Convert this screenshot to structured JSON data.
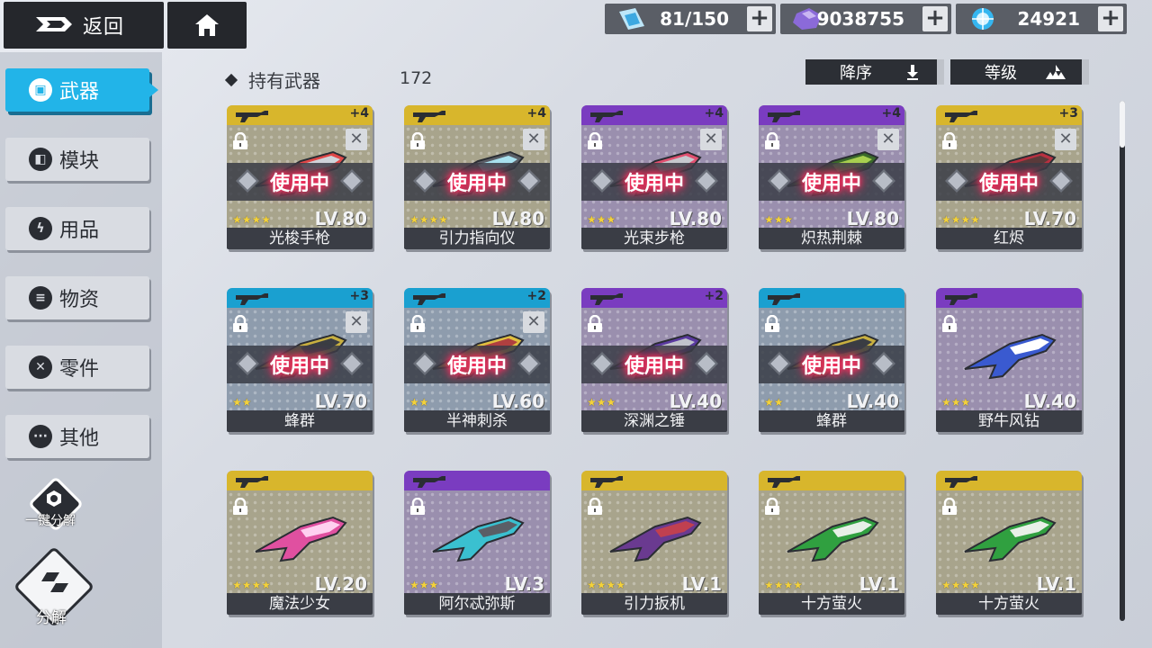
{
  "topbar": {
    "back_label": "返回",
    "resources": [
      {
        "icon": "stamina-icon",
        "value": "81/150",
        "color": "#3da8e0"
      },
      {
        "icon": "crystal-icon",
        "value": "9038755",
        "color": "#8b6ad9"
      },
      {
        "icon": "energy-orb-icon",
        "value": "24921",
        "color": "#35b6f0"
      }
    ],
    "plus_label": "+"
  },
  "sidebar": {
    "items": [
      {
        "label": "武器",
        "icon": "weapon-icon",
        "glyph": "▣",
        "active": true
      },
      {
        "label": "模块",
        "icon": "module-icon",
        "glyph": "◧",
        "active": false
      },
      {
        "label": "用品",
        "icon": "lightning-icon",
        "glyph": "ϟ",
        "active": false
      },
      {
        "label": "物资",
        "icon": "supplies-icon",
        "glyph": "≡",
        "active": false
      },
      {
        "label": "零件",
        "icon": "wrench-icon",
        "glyph": "✕",
        "active": false
      },
      {
        "label": "其他",
        "icon": "more-icon",
        "glyph": "···",
        "active": false
      }
    ],
    "quick_dismantle_label": "一键分解",
    "dismantle_label": "分解"
  },
  "header": {
    "owned_label": "持有武器",
    "owned_count": "172",
    "sort_order_label": "降序",
    "sort_by_label": "等级"
  },
  "colors": {
    "gold": "#d8b62c",
    "purple": "#7a3cc0",
    "blue": "#1aa0d0"
  },
  "weapons": [
    {
      "name": "光梭手枪",
      "level": "LV.80",
      "stars": "★★★★",
      "plus": "+4",
      "rarity": "gold",
      "in_use": true,
      "tool": true
    },
    {
      "name": "引力指向仪",
      "level": "LV.80",
      "stars": "★★★★",
      "plus": "+4",
      "rarity": "gold",
      "in_use": true,
      "tool": true
    },
    {
      "name": "光束步枪",
      "level": "LV.80",
      "stars": "★★★",
      "plus": "+4",
      "rarity": "purple",
      "in_use": true,
      "tool": true
    },
    {
      "name": "炽热荆棘",
      "level": "LV.80",
      "stars": "★★★",
      "plus": "+4",
      "rarity": "purple",
      "in_use": true,
      "tool": true
    },
    {
      "name": "红烬",
      "level": "LV.70",
      "stars": "★★★★",
      "plus": "+3",
      "rarity": "gold",
      "in_use": true,
      "tool": true
    },
    {
      "name": "蜂群",
      "level": "LV.70",
      "stars": "★★",
      "plus": "+3",
      "rarity": "blue",
      "in_use": true,
      "tool": true
    },
    {
      "name": "半神刺杀",
      "level": "LV.60",
      "stars": "★★",
      "plus": "+2",
      "rarity": "blue",
      "in_use": true,
      "tool": true
    },
    {
      "name": "深渊之锤",
      "level": "LV.40",
      "stars": "★★★",
      "plus": "+2",
      "rarity": "purple",
      "in_use": true,
      "tool": false
    },
    {
      "name": "蜂群",
      "level": "LV.40",
      "stars": "★★",
      "plus": "",
      "rarity": "blue",
      "in_use": true,
      "tool": false
    },
    {
      "name": "野牛风钻",
      "level": "LV.40",
      "stars": "★★★",
      "plus": "",
      "rarity": "purple",
      "in_use": false,
      "tool": false
    },
    {
      "name": "魔法少女",
      "level": "LV.20",
      "stars": "★★★★",
      "plus": "",
      "rarity": "gold",
      "in_use": false,
      "tool": false
    },
    {
      "name": "阿尔忒弥斯",
      "level": "LV.3",
      "stars": "★★★",
      "plus": "",
      "rarity": "purple",
      "in_use": false,
      "tool": false
    },
    {
      "name": "引力扳机",
      "level": "LV.1",
      "stars": "★★★★",
      "plus": "",
      "rarity": "gold",
      "in_use": false,
      "tool": false
    },
    {
      "name": "十方萤火",
      "level": "LV.1",
      "stars": "★★★★",
      "plus": "",
      "rarity": "gold",
      "in_use": false,
      "tool": false
    },
    {
      "name": "十方萤火",
      "level": "LV.1",
      "stars": "★★★★",
      "plus": "",
      "rarity": "gold",
      "in_use": false,
      "tool": false
    }
  ],
  "in_use_label": "使用中"
}
